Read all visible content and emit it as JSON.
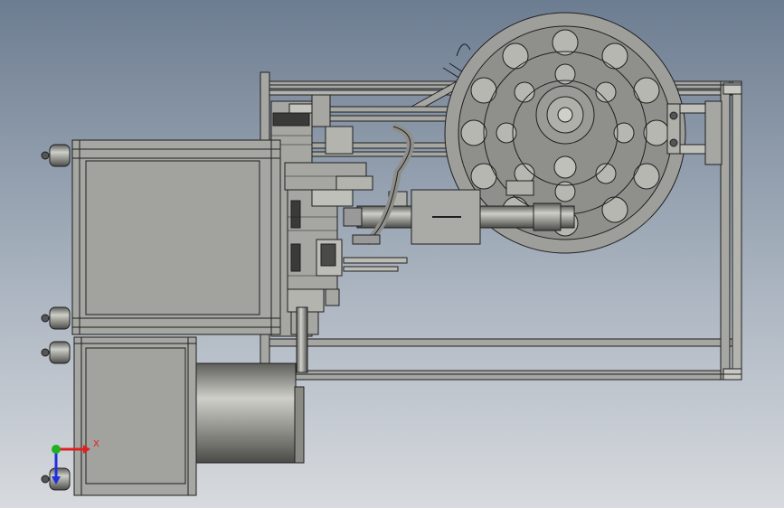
{
  "viewport": {
    "background_top": "#6d7d91",
    "background_bottom": "#d7dade",
    "model_fill": "#a6a6a2",
    "model_edge": "#1f1f1f"
  },
  "triad": {
    "x_label": "X",
    "x_color": "#e02020",
    "y_color": "#20b020",
    "z_color": "#2030e0"
  }
}
